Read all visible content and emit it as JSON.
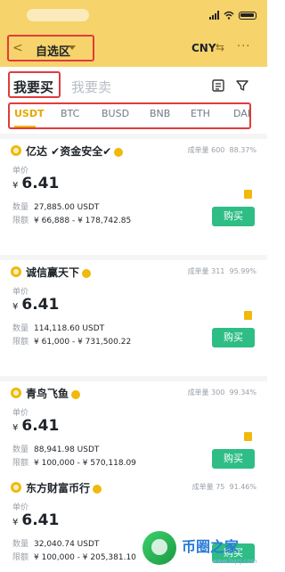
{
  "nav": {
    "back_icon": "back-arrow-icon",
    "title": "自选区",
    "currency": "CNY",
    "swap_icon": "swap-icon",
    "more_icon": "more-icon"
  },
  "tabs": {
    "buy": "我要买",
    "sell": "我要卖",
    "order_icon": "order-list-icon",
    "filter_icon": "filter-icon"
  },
  "coins": [
    "USDT",
    "BTC",
    "BUSD",
    "BNB",
    "ETH",
    "DAI"
  ],
  "active_coin": "USDT",
  "labels": {
    "price": "单价",
    "quantity": "数量",
    "limit": "限额",
    "orders_prefix": "成单量"
  },
  "offers": [
    {
      "merchant": "亿达 ✔资金安全✔",
      "orders": "600",
      "rate": "88.37%",
      "currency": "¥",
      "price": "6.41",
      "quantity": "27,885.00 USDT",
      "limit": "¥ 66,888 - ¥ 178,742.85",
      "button": "购买"
    },
    {
      "merchant": "诚信赢天下",
      "orders": "311",
      "rate": "95.99%",
      "currency": "¥",
      "price": "6.41",
      "quantity": "114,118.60 USDT",
      "limit": "¥ 61,000 - ¥ 731,500.22",
      "button": "购买"
    },
    {
      "merchant": "青鸟飞鱼",
      "orders": "300",
      "rate": "99.34%",
      "currency": "¥",
      "price": "6.41",
      "quantity": "88,941.98 USDT",
      "limit": "¥ 100,000 - ¥ 570,118.09",
      "button": "购买"
    },
    {
      "merchant": "东方财富币行",
      "orders": "75",
      "rate": "91.46%",
      "currency": "¥",
      "price": "6.41",
      "quantity": "32,040.74 USDT",
      "limit": "¥ 100,000 - ¥ 205,381.10",
      "button": "购买"
    }
  ],
  "watermark": {
    "text": "币圈之家",
    "url": "www.bqzj.com"
  },
  "colors": {
    "header": "#f6d36b",
    "accent": "#f0b90b",
    "buy": "#2ebd85",
    "highlight": "#e23b3b"
  }
}
